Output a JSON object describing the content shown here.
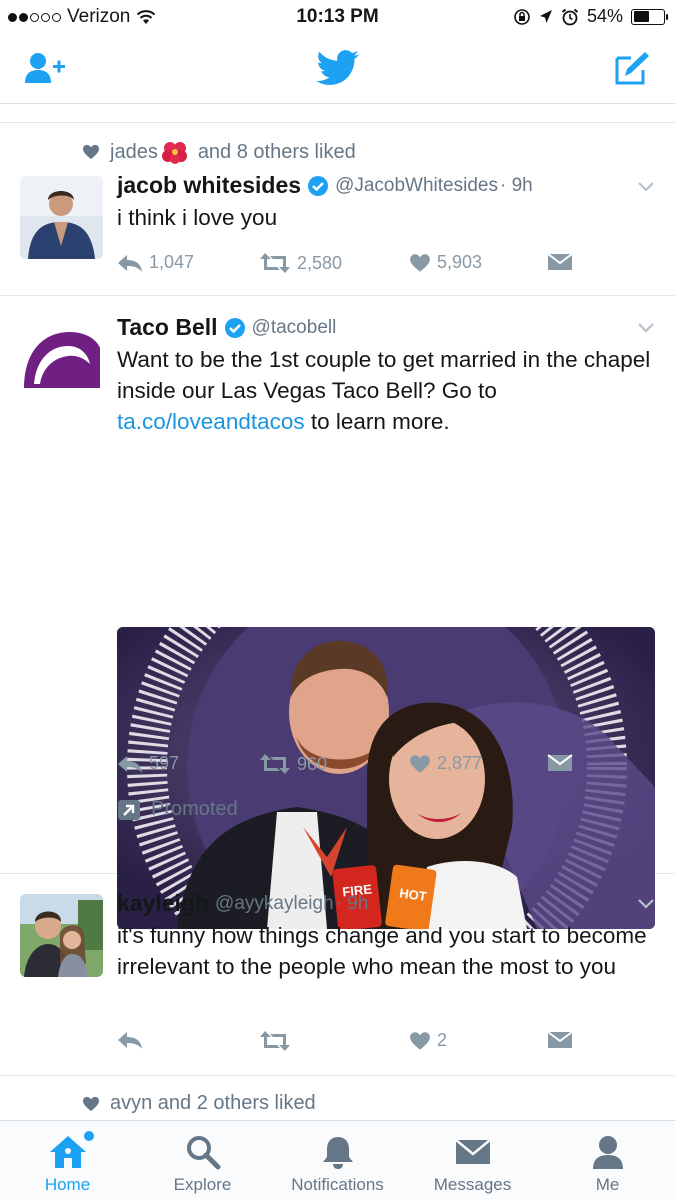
{
  "status_bar": {
    "carrier": "Verizon",
    "time": "10:13 PM",
    "battery": "54%",
    "battery_level": 0.54
  },
  "nav": {
    "compose_icon": "compose-icon",
    "logo_icon": "twitter-bird-icon",
    "add_user_icon": "add-user-icon"
  },
  "tweets": [
    {
      "social": "jades      and 8 others liked",
      "social_prefix": "jades",
      "social_suffix": "and 8 others liked",
      "name": "jacob whitesides",
      "verified": true,
      "handle": "@JacobWhitesides",
      "time": "· 9h",
      "text": "i think i love you",
      "replies": "1,047",
      "retweets": "2,580",
      "likes": "5,903"
    },
    {
      "name": "Taco Bell",
      "verified": true,
      "handle": "@tacobell",
      "text_before": "Want to be the 1st couple to get married in the chapel inside our Las Vegas Taco Bell? Go to ",
      "link": "ta.co/loveandtacos",
      "text_after": " to learn more.",
      "replies": "597",
      "retweets": "960",
      "likes": "2,877",
      "promoted": "Promoted",
      "sauce_left": "FIRE",
      "sauce_right": "HOT"
    },
    {
      "name": "kayleigh",
      "handle": "@ayykayleigh",
      "time": "· 9h",
      "text": "it's funny how things change and you start to become irrelevant to the people who mean the most to you",
      "likes": "2"
    },
    {
      "social": "avyn and 2 others liked"
    }
  ],
  "tabs": [
    {
      "label": "Home",
      "icon": "home-icon",
      "active": true
    },
    {
      "label": "Explore",
      "icon": "search-icon",
      "active": false
    },
    {
      "label": "Notifications",
      "icon": "bell-icon",
      "active": false
    },
    {
      "label": "Messages",
      "icon": "envelope-icon",
      "active": false
    },
    {
      "label": "Me",
      "icon": "person-icon",
      "active": false
    }
  ],
  "colors": {
    "brand": "#1da1f2",
    "muted": "#8899a6",
    "link": "#1b95e0",
    "taco_purple": "#702082"
  }
}
